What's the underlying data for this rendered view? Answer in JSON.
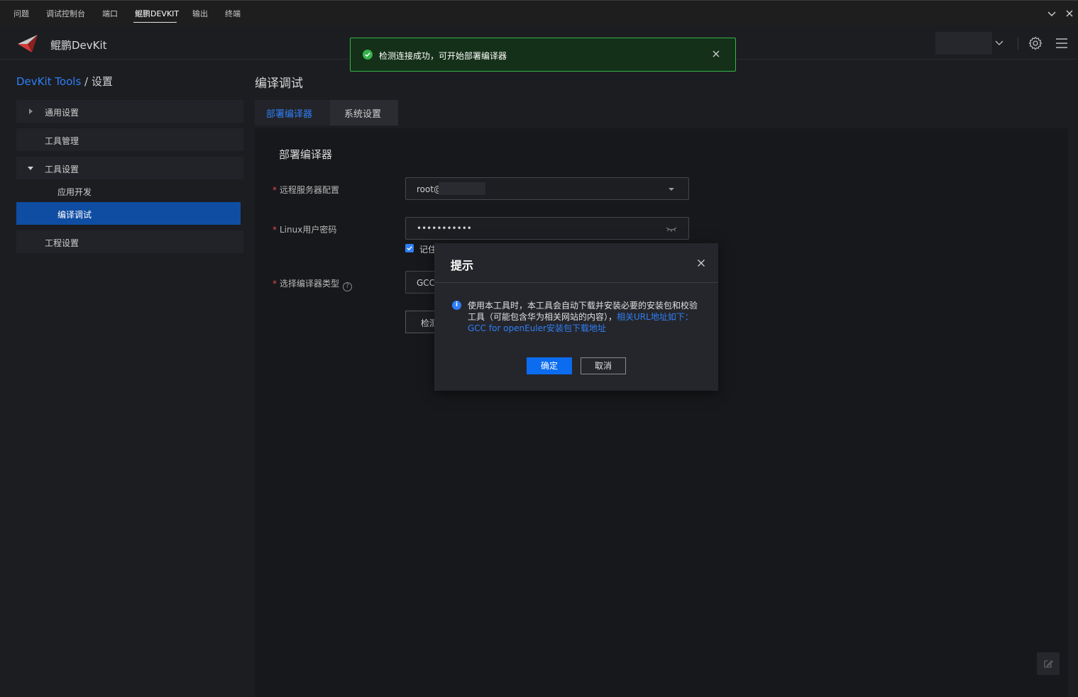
{
  "panel_tabs": [
    {
      "label": "问题"
    },
    {
      "label": "调试控制台"
    },
    {
      "label": "端口"
    },
    {
      "label": "鲲鹏DEVKIT"
    },
    {
      "label": "输出"
    },
    {
      "label": "终端"
    }
  ],
  "app": {
    "name": "鲲鹏DevKit"
  },
  "breadcrumb": {
    "root": "DevKit Tools",
    "separator": "/",
    "current": "设置"
  },
  "sidebar": {
    "items": [
      {
        "label": "通用设置"
      },
      {
        "label": "工具管理"
      },
      {
        "label": "工具设置"
      },
      {
        "label": "工程设置"
      }
    ],
    "sub_items": [
      {
        "label": "应用开发"
      },
      {
        "label": "编译调试"
      }
    ]
  },
  "main": {
    "title": "编译调试",
    "tabs": [
      {
        "label": "部署编译器"
      },
      {
        "label": "系统设置"
      }
    ],
    "section_title": "部署编译器",
    "form": {
      "remote_server": {
        "label": "远程服务器配置",
        "value": "root@"
      },
      "password": {
        "label": "Linux用户密码",
        "value": "•••••••••••"
      },
      "remember": {
        "label": "记住"
      },
      "compiler_type": {
        "label": "选择编译器类型",
        "value": "GCC"
      },
      "detect_button": {
        "label": "检测"
      }
    }
  },
  "toast": {
    "message": "检测连接成功，可开始部署编译器",
    "status_color": "#35b34a"
  },
  "modal": {
    "title": "提示",
    "body_text": "使用本工具时，本工具会自动下载并安装必要的安装包和校验工具（可能包含华为相关网站的内容），",
    "body_link": "相关URL地址如下：",
    "body_link2": "GCC for openEuler安装包下载地址",
    "ok_label": "确定",
    "cancel_label": "取消"
  },
  "colors": {
    "accent": "#2f7ff5",
    "selected_nav": "#0f4da3",
    "background": "#1c1d21"
  }
}
